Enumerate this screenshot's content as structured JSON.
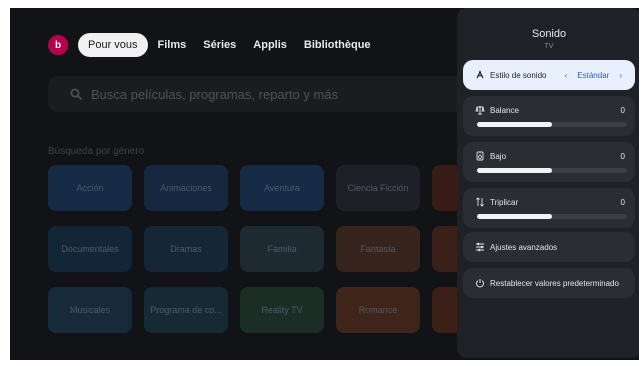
{
  "nav": {
    "avatar_letter": "b",
    "tabs": [
      "Pour vous",
      "Films",
      "Séries",
      "Applis",
      "Bibliothèque"
    ]
  },
  "search": {
    "placeholder": "Busca películas, programas, reparto y más"
  },
  "genres": {
    "title": "Búsqueda por género",
    "tiles": [
      {
        "label": "Acción",
        "color": "#152a45"
      },
      {
        "label": "Animaciones",
        "color": "#15283f"
      },
      {
        "label": "Aventura",
        "color": "#142a45"
      },
      {
        "label": "Ciencia Ficción",
        "color": "#1e2028"
      },
      {
        "label": "",
        "color": "#3a1c17"
      },
      {
        "label": "Documentales",
        "color": "#132638"
      },
      {
        "label": "Dramas",
        "color": "#152637"
      },
      {
        "label": "Familia",
        "color": "#1d2a32"
      },
      {
        "label": "Fantasía",
        "color": "#37241d"
      },
      {
        "label": "",
        "color": "#3b1f19"
      },
      {
        "label": "Musicales",
        "color": "#172a3a"
      },
      {
        "label": "Programa de co...",
        "color": "#162a36"
      },
      {
        "label": "Reality TV",
        "color": "#1a2e26"
      },
      {
        "label": "Romance",
        "color": "#3e2419"
      },
      {
        "label": "",
        "color": "#3c2017"
      }
    ]
  },
  "panel": {
    "title": "Sonido",
    "subtitle": "TV",
    "sound_style": {
      "label": "Estilo de sonido",
      "value": "Estándar",
      "prev": "‹",
      "next": "›"
    },
    "sliders": [
      {
        "label": "Balance",
        "value": "0",
        "level": 0.5
      },
      {
        "label": "Bajo",
        "value": "0",
        "level": 0.5
      },
      {
        "label": "Triplicar",
        "value": "0",
        "level": 0.5
      }
    ],
    "advanced": "Ajustes avanzados",
    "reset": "Restablecer valores predeterminado"
  }
}
